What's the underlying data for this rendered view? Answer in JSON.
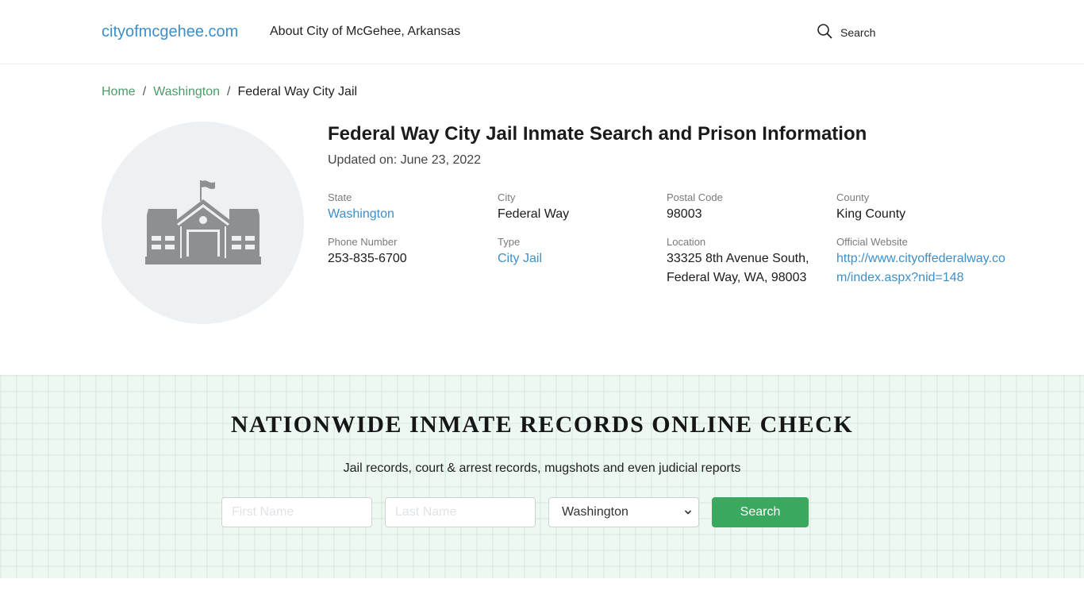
{
  "header": {
    "brand": "cityofmcgehee.com",
    "nav_about": "About City of McGehee, Arkansas",
    "search_label": "Search",
    "search_icon": "search-icon"
  },
  "breadcrumb": {
    "items": [
      {
        "label": "Home"
      },
      {
        "label": "Washington"
      },
      {
        "label": "Federal Way City Jail"
      }
    ],
    "separator": "/"
  },
  "facility": {
    "image_icon": "school-building-icon",
    "title": "Federal Way City Jail Inmate Search and Prison Information",
    "updated": "Updated on: June 23, 2022",
    "fields": [
      {
        "label": "State",
        "value": "Washington",
        "link": true
      },
      {
        "label": "City",
        "value": "Federal Way",
        "link": false
      },
      {
        "label": "Postal Code",
        "value": "98003",
        "link": false
      },
      {
        "label": "County",
        "value": "King County",
        "link": false
      },
      {
        "label": "Phone Number",
        "value": "253-835-6700",
        "link": false
      },
      {
        "label": "Type",
        "value": "City Jail",
        "link": true
      },
      {
        "label": "Location",
        "value": "33325 8th Avenue South, Federal Way, WA, 98003",
        "link": false
      },
      {
        "label": "Official Website",
        "value": "http://www.cityoffederalway.com/index.aspx?nid=148",
        "link": true
      }
    ]
  },
  "search_section": {
    "title": "NATIONWIDE INMATE RECORDS ONLINE CHECK",
    "subtitle": "Jail records, court & arrest records, mugshots and even judicial reports",
    "first_name_placeholder": "First Name",
    "last_name_placeholder": "Last Name",
    "first_name_value": "",
    "last_name_value": "",
    "state_selected": "Washington",
    "button_label": "Search"
  },
  "colors": {
    "brand_blue": "#3d8fc9",
    "breadcrumb_green": "#4a9e68",
    "button_green": "#3aa960",
    "section_bg": "#ecf8f1",
    "icon_gray": "#8e8f91",
    "circle_bg": "#edf1f4"
  }
}
